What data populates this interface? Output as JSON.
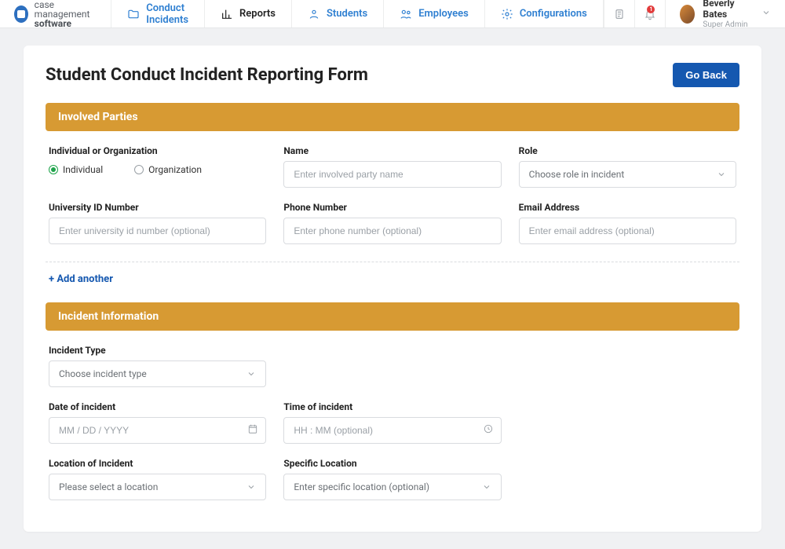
{
  "brand": {
    "line1": "case management",
    "line2": "software"
  },
  "nav": {
    "items": [
      {
        "label": "Conduct Incidents"
      },
      {
        "label": "Reports"
      },
      {
        "label": "Students"
      },
      {
        "label": "Employees"
      },
      {
        "label": "Configurations"
      }
    ]
  },
  "notifications": {
    "count": "1"
  },
  "user": {
    "name": "Beverly Bates",
    "role": "Super Admin"
  },
  "page": {
    "title": "Student Conduct Incident Reporting Form",
    "go_back": "Go Back"
  },
  "sections": {
    "involved_parties": {
      "header": "Involved Parties",
      "individual_or_org_label": "Individual or Organization",
      "radio_individual": "Individual",
      "radio_organization": "Organization",
      "name_label": "Name",
      "name_placeholder": "Enter involved party name",
      "role_label": "Role",
      "role_placeholder": "Choose role in incident",
      "uid_label": "University ID Number",
      "uid_placeholder": "Enter university id number (optional)",
      "phone_label": "Phone Number",
      "phone_placeholder": "Enter phone number (optional)",
      "email_label": "Email Address",
      "email_placeholder": "Enter email address (optional)",
      "add_another": "+ Add another"
    },
    "incident_info": {
      "header": "Incident Information",
      "type_label": "Incident Type",
      "type_placeholder": "Choose incident type",
      "date_label": "Date of incident",
      "date_placeholder": "MM / DD / YYYY",
      "time_label": "Time of incident",
      "time_placeholder": "HH : MM (optional)",
      "location_label": "Location of Incident",
      "location_placeholder": "Please select a location",
      "specific_label": "Specific Location",
      "specific_placeholder": "Enter specific location (optional)"
    }
  }
}
